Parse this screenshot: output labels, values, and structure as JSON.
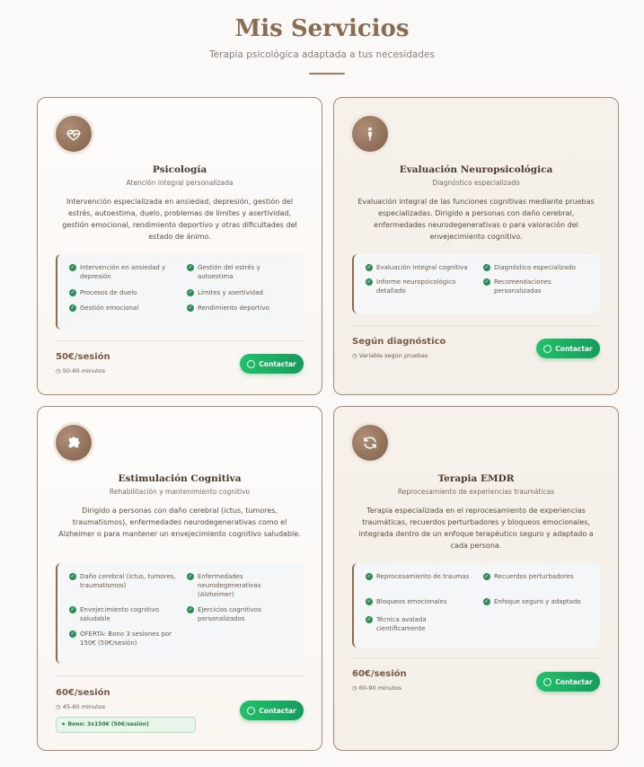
{
  "header": {
    "title": "Mis Servicios",
    "subtitle": "Terapia psicológica adaptada a tus necesidades"
  },
  "colors": {
    "accent": "#8b6b52",
    "whatsapp": "#22c06a",
    "check": "#2e8b57"
  },
  "cards": [
    {
      "icon": "heart-pulse-icon",
      "title": "Psicología",
      "subtitle": "Atención integral personalizada",
      "description": "Intervención especializada en ansiedad, depresión, gestión del estrés, autoestima, duelo, problemas de límites y asertividad, gestión emocional, rendimiento deportivo y otras dificultades del estado de ánimo.",
      "features": [
        "Intervención en ansiedad y depresión",
        "Gestión del estrés y autoestima",
        "Procesos de duelo",
        "Límites y asertividad",
        "Gestión emocional",
        "Rendimiento deportivo"
      ],
      "price": "50€/sesión",
      "duration": "50-60 minutos",
      "button": "Contactar"
    },
    {
      "icon": "person-icon",
      "title": "Evaluación Neuropsicológica",
      "subtitle": "Diagnóstico especializado",
      "description": "Evaluación integral de las funciones cognitivas mediante pruebas especializadas. Dirigido a personas con daño cerebral, enfermedades neurodegenerativas o para valoración del envejecimiento cognitivo.",
      "features": [
        "Evaluación integral cognitiva",
        "Diagnóstico especializado",
        "Informe neuropsicológico detallado",
        "Recomendaciones personalizadas"
      ],
      "price": "Según diagnóstico",
      "duration": "Variable según pruebas",
      "button": "Contactar"
    },
    {
      "icon": "puzzle-icon",
      "title": "Estimulación Cognitiva",
      "subtitle": "Rehabilitación y mantenimiento cognitivo",
      "description": "Dirigido a personas con daño cerebral (ictus, tumores, traumatismos), enfermedades neurodegenerativas como el Alzheimer o para mantener un envejecimiento cognitivo saludable.",
      "features": [
        "Daño cerebral (ictus, tumores, traumatismos)",
        "Enfermedades neurodegenerativas (Alzheimer)",
        "Envejecimiento cognitivo saludable",
        "Ejercicios cognitivos personalizados",
        "OFERTA: Bono 3 sesiones por 150€ (50€/sesión)"
      ],
      "price": "60€/sesión",
      "duration": "45-60 minutos",
      "bono": "★ Bono: 3x150€ (50€/sesión)",
      "button": "Contactar"
    },
    {
      "icon": "sync-icon",
      "title": "Terapia EMDR",
      "subtitle": "Reprocesamiento de experiencias traumáticas",
      "description": "Terapia especializada en el reprocesamiento de experiencias traumáticas, recuerdos perturbadores y bloqueos emocionales, integrada dentro de un enfoque terapéutico seguro y adaptado a cada persona.",
      "features": [
        "Reprocesamiento de traumas",
        "Recuerdos perturbadores",
        "Bloqueos emocionales",
        "Enfoque seguro y adaptado",
        "Técnica avalada científicamente"
      ],
      "price": "60€/sesión",
      "duration": "60-90 minutos",
      "button": "Contactar"
    }
  ]
}
